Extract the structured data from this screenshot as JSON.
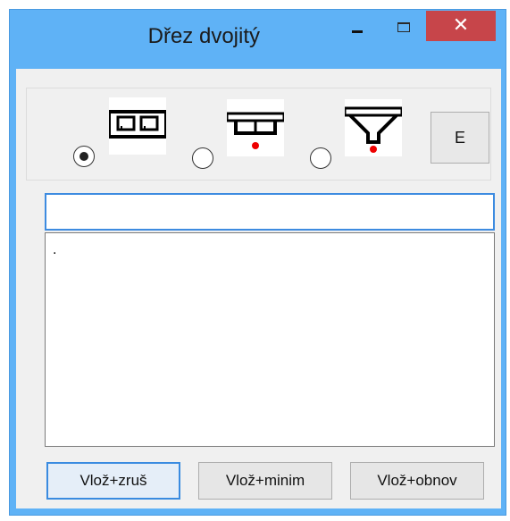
{
  "window": {
    "title": "Dřez dvojitý",
    "minimize_glyph": "–",
    "close_glyph": "✕"
  },
  "options": {
    "selected_index": 0,
    "items": [
      {
        "icon": "double-sink-icon",
        "selected": true
      },
      {
        "icon": "sink-with-drain-icon",
        "selected": false
      },
      {
        "icon": "funnel-sink-icon",
        "selected": false
      }
    ],
    "e_button_label": "E"
  },
  "inputs": {
    "single_line_value": "",
    "multi_line_value": "."
  },
  "buttons": {
    "insert_close": "Vlož+zruš",
    "insert_minimize": "Vlož+minim",
    "insert_restore": "Vlož+obnov"
  }
}
